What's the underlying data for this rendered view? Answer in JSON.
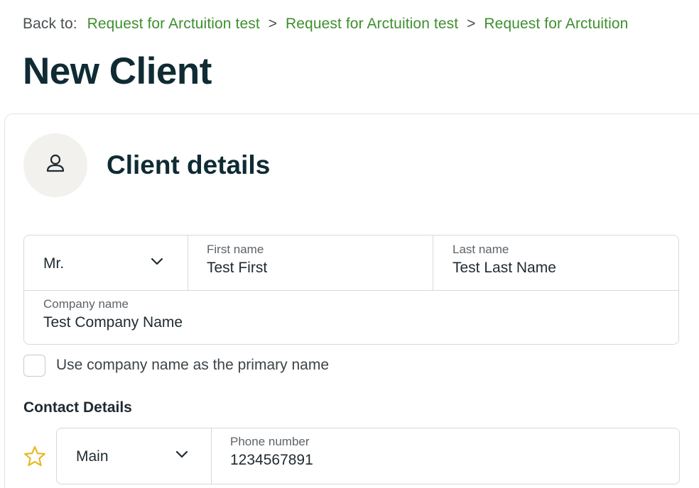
{
  "breadcrumb": {
    "back_label": "Back to:",
    "items": [
      "Request for Arctuition test",
      "Request for Arctuition test",
      "Request for Arctuition"
    ],
    "separator": ">"
  },
  "page_title": "New Client",
  "client_details": {
    "title": "Client details",
    "icon": "person-icon",
    "salutation": "Mr.",
    "first_name": {
      "label": "First name",
      "value": "Test First"
    },
    "last_name": {
      "label": "Last name",
      "value": "Test Last Name"
    },
    "company_name": {
      "label": "Company name",
      "value": "Test Company Name"
    },
    "use_company_checkbox": {
      "label": "Use company name as the primary name",
      "checked": false
    }
  },
  "contact_details": {
    "title": "Contact Details",
    "phone": {
      "type": "Main",
      "label": "Phone number",
      "value": "1234567891",
      "primary_icon": "star-icon"
    }
  },
  "colors": {
    "link": "#3f8f2f",
    "heading": "#0f2b33",
    "star": "#e8b823",
    "border": "#d9d9d6"
  }
}
